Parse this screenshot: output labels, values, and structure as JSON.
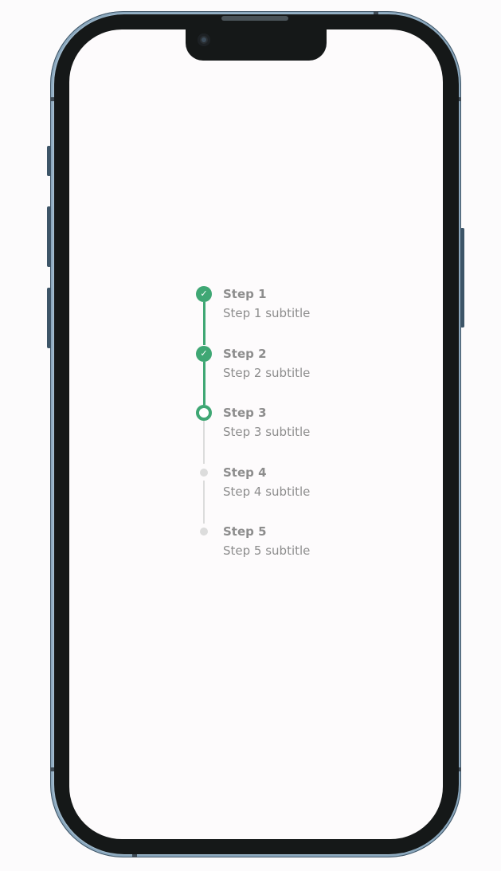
{
  "device": {
    "type": "phone-mockup"
  },
  "colors": {
    "accent": "#3fa774",
    "inactive": "#dcdcdc",
    "text": "#8d8d8d",
    "frame": "#8aa7bd",
    "bezel": "#151818",
    "screen": "#fdfbfc"
  },
  "stepper": {
    "steps": [
      {
        "title": "Step 1",
        "subtitle": "Step 1 subtitle",
        "status": "completed",
        "icon": "check-icon"
      },
      {
        "title": "Step 2",
        "subtitle": "Step 2 subtitle",
        "status": "completed",
        "icon": "check-icon"
      },
      {
        "title": "Step 3",
        "subtitle": "Step 3 subtitle",
        "status": "current",
        "icon": "ring-icon"
      },
      {
        "title": "Step 4",
        "subtitle": "Step 4 subtitle",
        "status": "pending",
        "icon": "dot-icon"
      },
      {
        "title": "Step 5",
        "subtitle": "Step 5 subtitle",
        "status": "pending",
        "icon": "dot-icon"
      }
    ]
  }
}
